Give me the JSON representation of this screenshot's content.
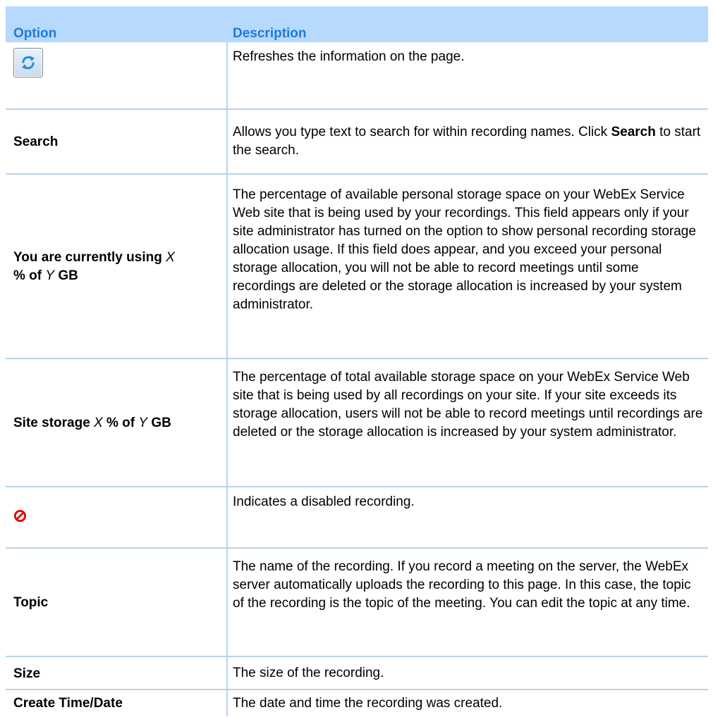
{
  "table": {
    "header": {
      "option": "Option",
      "description": "Description"
    },
    "rows": [
      {
        "option_icon": "refresh-icon",
        "description": "Refreshes the information on the page."
      },
      {
        "option": "Search",
        "description_pre": "Allows you type text to search for within recording names. Click ",
        "description_bold": "Search",
        "description_post": " to start the search."
      },
      {
        "option_part1": "You are currently using ",
        "option_var1": "X",
        "option_part2": "% of ",
        "option_var2": "Y",
        "option_part3": " GB",
        "description": "The percentage of available personal storage space on your WebEx Service Web site that is being used by your recordings. This field appears only if your site administrator has turned on the option to show personal recording storage allocation usage. If this field does appear, and you exceed your personal storage allocation, you will not be able to record meetings until some recordings are deleted or the storage allocation is increased by your system administrator."
      },
      {
        "option_part1": "Site storage ",
        "option_var1": "X",
        "option_part2": " % of ",
        "option_var2": "Y",
        "option_part3": " GB",
        "description": "The percentage of total available storage space on your WebEx Service Web site that is being used by all recordings on your site. If your site exceeds its storage allocation, users will not be able to record meetings until recordings are deleted or the storage allocation is increased by your system administrator."
      },
      {
        "option_icon": "disabled-icon",
        "description": "Indicates a disabled recording."
      },
      {
        "option": "Topic",
        "description": "The name of the recording. If you record a meeting on the server, the WebEx server automatically uploads the recording to this page. In this case, the topic of the recording is the topic of the meeting. You can edit the topic at any time."
      },
      {
        "option": "Size",
        "description": "The size of the recording."
      },
      {
        "option": "Create Time/Date",
        "description": "The date and time the recording was created."
      }
    ]
  },
  "colors": {
    "header_bg": "#b6d9fd",
    "header_text": "#1f7bd7",
    "grid_line": "#b9d2ea",
    "refresh_arrows": "#2a8fd6",
    "disabled_red": "#e00000"
  }
}
